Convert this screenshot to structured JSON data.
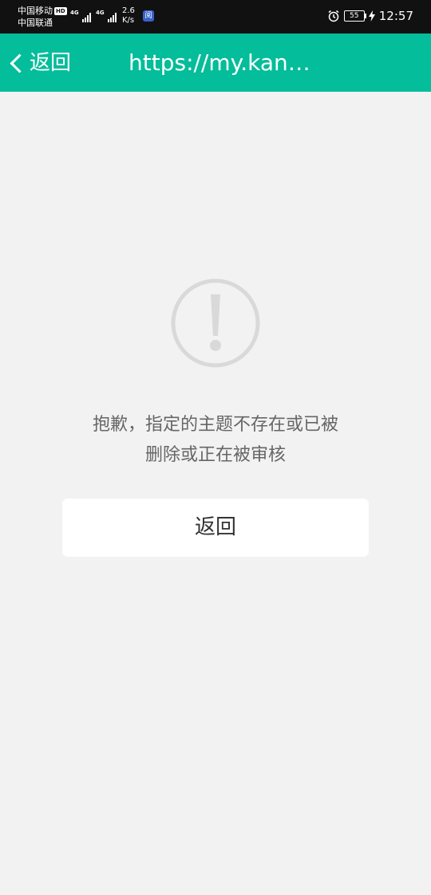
{
  "status_bar": {
    "carrier_1": "中国移动",
    "hd_badge": "HD",
    "carrier_2": "中国联通",
    "network_1": "4G",
    "network_2": "4G",
    "speed_value": "2.6",
    "speed_unit": "K/s",
    "app_icon_char": "阅",
    "battery_level": "55",
    "time": "12:57",
    "icons": [
      "alarm-icon",
      "battery-icon",
      "charging-icon",
      "signal-icon"
    ]
  },
  "nav": {
    "back_label": "返回",
    "title": "https://my.kan…",
    "background_color": "#04bd9a"
  },
  "error": {
    "icon": "exclamation-circle-icon",
    "line_1": "抱歉，指定的主题不存在或已被",
    "line_2": "删除或正在被审核",
    "button_label": "返回"
  }
}
